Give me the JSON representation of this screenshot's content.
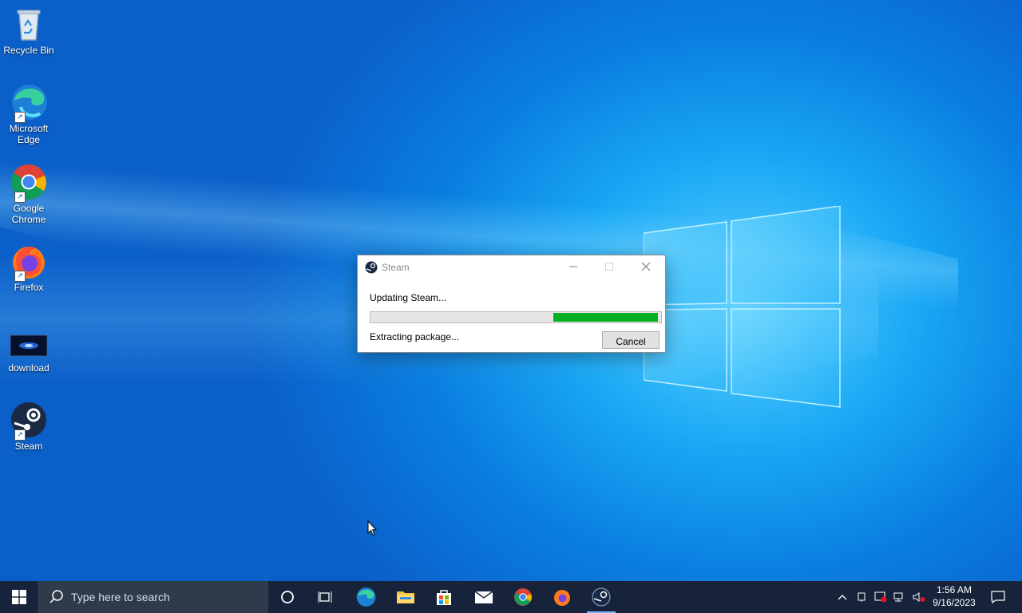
{
  "desktop": {
    "icons": [
      {
        "label": "Recycle Bin"
      },
      {
        "label": "Microsoft Edge"
      },
      {
        "label": "Google Chrome"
      },
      {
        "label": "Firefox"
      },
      {
        "label": "download"
      },
      {
        "label": "Steam"
      }
    ]
  },
  "dialog": {
    "title": "Steam",
    "message": "Updating Steam...",
    "status": "Extracting package...",
    "cancel_label": "Cancel",
    "progress": 0.36,
    "progress_color": "#06b025"
  },
  "taskbar": {
    "search_placeholder": "Type here to search",
    "apps": [
      "cortana-icon",
      "task-view-icon",
      "edge-icon",
      "file-explorer-icon",
      "store-icon",
      "mail-icon",
      "chrome-icon",
      "firefox-icon",
      "steam-icon"
    ],
    "clock": {
      "time": "1:56 AM",
      "date": "9/16/2023"
    }
  },
  "colors": {
    "taskbar": "#16233a",
    "accent": "#0a7fe0"
  }
}
